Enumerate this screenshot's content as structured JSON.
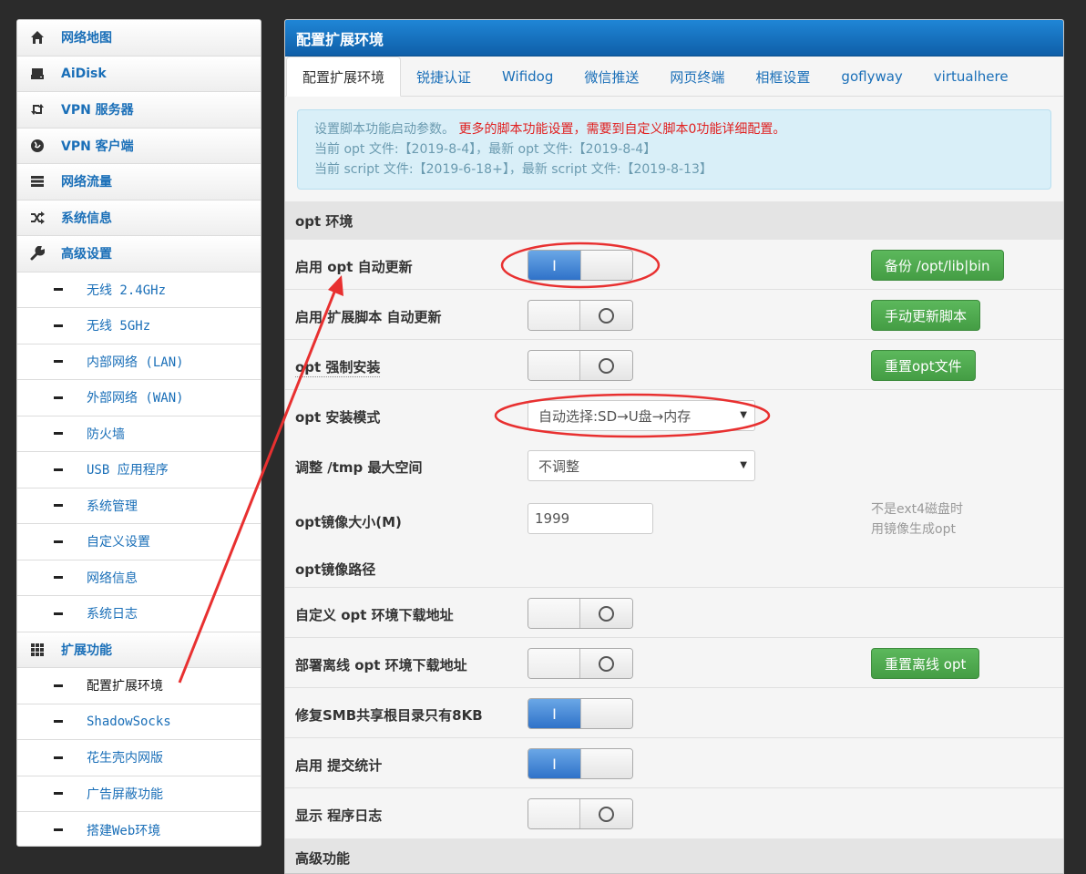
{
  "sidebar": {
    "items": [
      {
        "label": "网络地图",
        "icon": "home-icon"
      },
      {
        "label": "AiDisk",
        "icon": "disk-icon"
      },
      {
        "label": "VPN 服务器",
        "icon": "vpn-server-icon"
      },
      {
        "label": "VPN 客户端",
        "icon": "globe-icon"
      },
      {
        "label": "网络流量",
        "icon": "traffic-icon"
      },
      {
        "label": "系统信息",
        "icon": "shuffle-icon"
      },
      {
        "label": "高级设置",
        "icon": "wrench-icon"
      }
    ],
    "advanced_sub": [
      "无线 2.4GHz",
      "无线 5GHz",
      "内部网络 (LAN)",
      "外部网络 (WAN)",
      "防火墙",
      "USB 应用程序",
      "系统管理",
      "自定义设置",
      "网络信息",
      "系统日志"
    ],
    "extension": {
      "label": "扩展功能",
      "icon": "grid-icon"
    },
    "extension_sub": [
      "配置扩展环境",
      "ShadowSocks",
      "花生壳内网版",
      "广告屏蔽功能",
      "搭建Web环境"
    ]
  },
  "panel": {
    "title": "配置扩展环境",
    "tabs": [
      "配置扩展环境",
      "锐捷认证",
      "Wifidog",
      "微信推送",
      "网页终端",
      "相框设置",
      "goflyway",
      "virtualhere"
    ],
    "info": {
      "line1_a": "设置脚本功能启动参数。",
      "line1_b": "更多的脚本功能设置，需要到自定义脚本0功能详细配置。",
      "line2": "当前 opt 文件:【2019-8-4】，最新 opt 文件:【2019-8-4】",
      "line3": "当前 script 文件:【2019-6-18+】，最新 script 文件:【2019-8-13】"
    },
    "section_opt": "opt 环境",
    "rows": {
      "auto_update": {
        "label": "启用 opt 自动更新",
        "state": "on",
        "toggle_on_text": "I",
        "button": "备份 /opt/lib|bin"
      },
      "script_update": {
        "label": "启用 扩展脚本 自动更新",
        "state": "off",
        "button": "手动更新脚本"
      },
      "force_install": {
        "label": "opt 强制安装",
        "state": "off",
        "button": "重置opt文件"
      },
      "install_mode": {
        "label": "opt 安装模式",
        "select": "自动选择:SD→U盘→内存"
      },
      "tmp_space": {
        "label": "调整 /tmp 最大空间",
        "select": "不调整"
      },
      "image_size": {
        "label": "opt镜像大小(M)",
        "value": "1999",
        "note_1": "不是ext4磁盘时",
        "note_2": "用镜像生成opt"
      },
      "image_path": {
        "label": "opt镜像路径"
      },
      "custom_url": {
        "label": "自定义 opt 环境下载地址",
        "state": "off"
      },
      "offline_url": {
        "label": "部署离线 opt 环境下载地址",
        "state": "off",
        "button": "重置离线 opt"
      },
      "smb_fix": {
        "label": "修复SMB共享根目录只有8KB",
        "state": "on",
        "toggle_on_text": "I"
      },
      "stats": {
        "label": "启用 提交统计",
        "state": "on",
        "toggle_on_text": "I"
      },
      "log": {
        "label": "显示 程序日志",
        "state": "off"
      }
    },
    "section_advanced": "高级功能"
  },
  "annotation_color": "#e83030"
}
